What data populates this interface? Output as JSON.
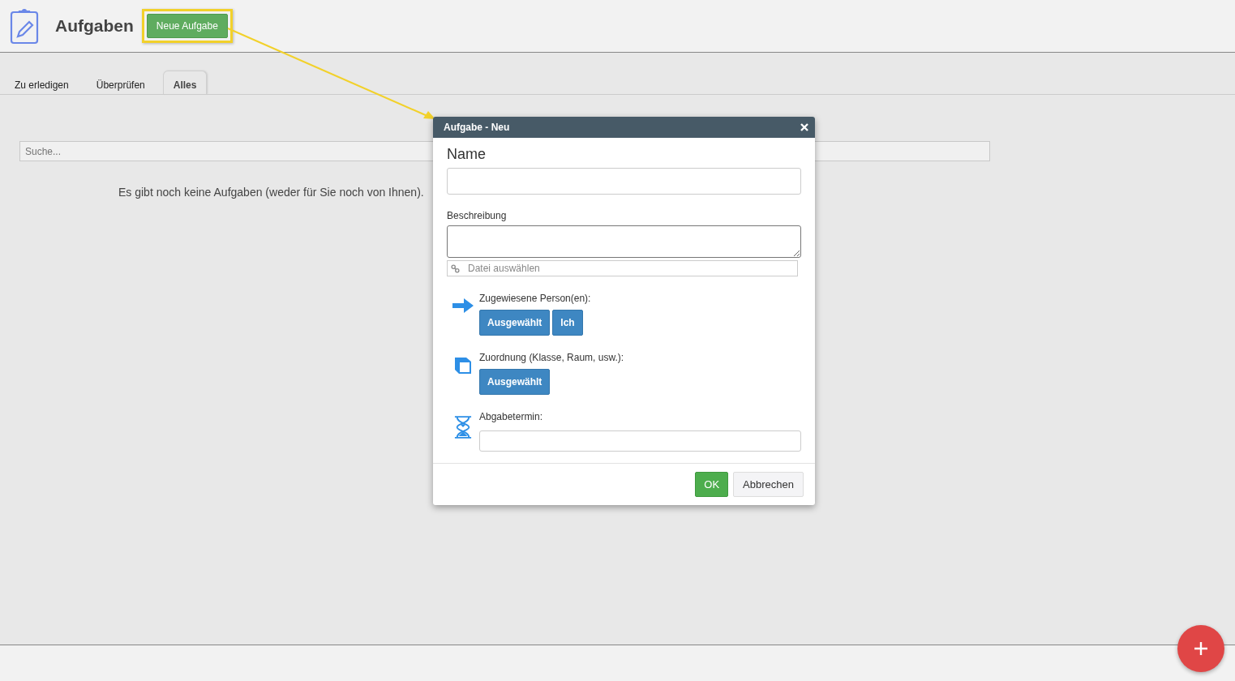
{
  "header": {
    "title": "Aufgaben",
    "new_button": "Neue Aufgabe"
  },
  "tabs": [
    {
      "label": "Zu erledigen",
      "selected": false
    },
    {
      "label": "Überprüfen",
      "selected": false
    },
    {
      "label": "Alles",
      "selected": true
    }
  ],
  "search": {
    "placeholder": "Suche..."
  },
  "empty_message": "Es gibt noch keine Aufgaben (weder für Sie noch von Ihnen).",
  "dialog": {
    "title": "Aufgabe - Neu",
    "name_label": "Name",
    "description_label": "Beschreibung",
    "file_placeholder": "Datei auswählen",
    "sections": [
      {
        "kind": "buttons",
        "label": "Zugewiesene Person(en):",
        "buttons": [
          "Ausgewählt",
          "Ich"
        ]
      },
      {
        "kind": "buttons",
        "label": "Zuordnung (Klasse, Raum, usw.):",
        "buttons": [
          "Ausgewählt"
        ]
      },
      {
        "kind": "field",
        "label": "Abgabetermin:"
      }
    ],
    "ok": "OK",
    "cancel": "Abbrechen"
  }
}
